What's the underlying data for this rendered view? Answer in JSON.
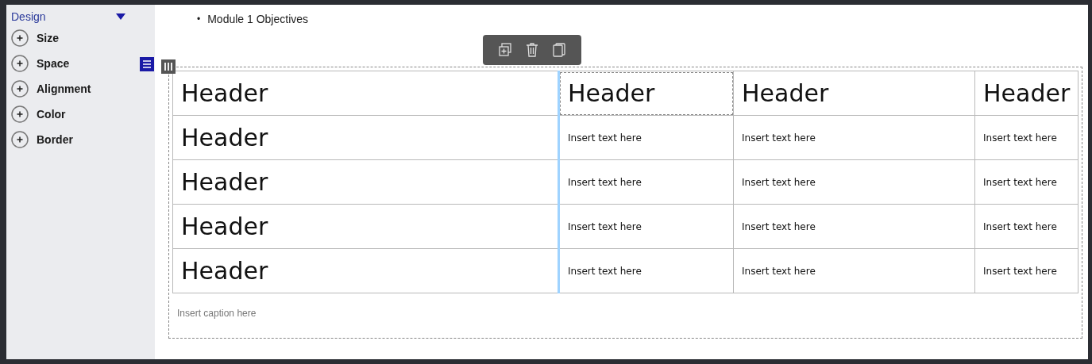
{
  "sidebar": {
    "title": "Design",
    "expanded": true,
    "items": [
      {
        "label": "Size"
      },
      {
        "label": "Space"
      },
      {
        "label": "Alignment"
      },
      {
        "label": "Color"
      },
      {
        "label": "Border"
      }
    ]
  },
  "content": {
    "bullets": [
      {
        "marker": "•",
        "text": "Module 1 Objectives"
      }
    ],
    "table": {
      "header": [
        {
          "text": "Header",
          "selected": false
        },
        {
          "text": "Header",
          "selected": true
        },
        {
          "text": "Header",
          "selected": false
        },
        {
          "text": "Header",
          "selected": false
        }
      ],
      "rows": [
        {
          "cells": [
            "Header",
            "Insert text here",
            "Insert text here",
            "Insert text here"
          ]
        },
        {
          "cells": [
            "Header",
            "Insert text here",
            "Insert text here",
            "Insert text here"
          ]
        },
        {
          "cells": [
            "Header",
            "Insert text here",
            "Insert text here",
            "Insert text here"
          ]
        },
        {
          "cells": [
            "Header",
            "Insert text here",
            "Insert text here",
            "Insert text here"
          ]
        }
      ],
      "caption": "Insert caption here"
    }
  }
}
